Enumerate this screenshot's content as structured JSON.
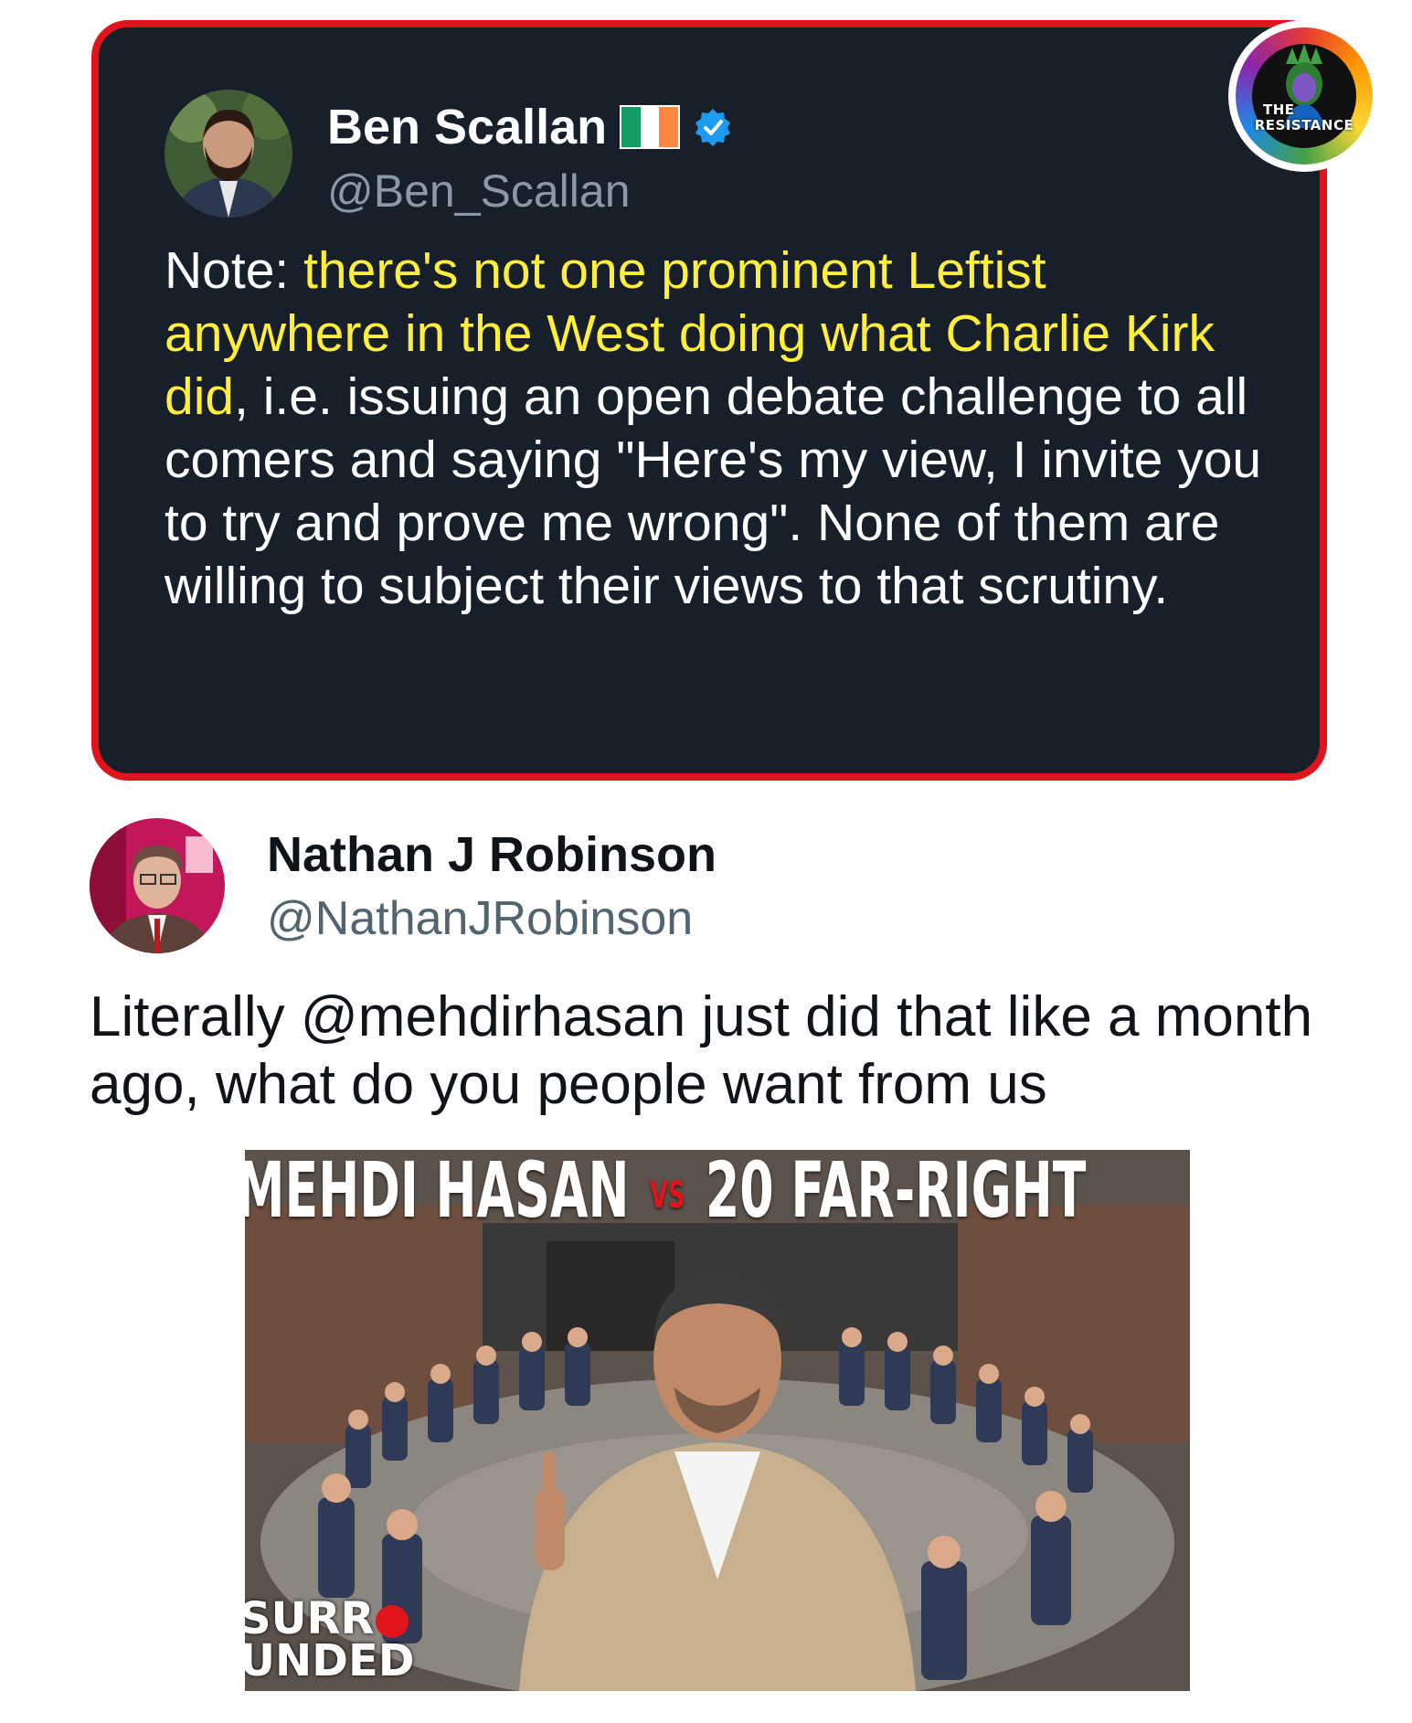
{
  "quoted_tweet": {
    "author_name": "Ben Scallan",
    "author_handle": "@Ben_Scallan",
    "flag_icon": "ireland-flag-icon",
    "verified_icon": "verified-badge-icon",
    "text_prefix": "Note: ",
    "text_highlight": "there's not one prominent Leftist anywhere in the West doing what Charlie Kirk did",
    "text_rest": ", i.e. issuing an open debate challenge to all comers and saying \"Here's my view, I invite you to try and prove me wrong\". None of them are willing to subject their views to that scrutiny.",
    "highlight_color": "#ffef3a",
    "border_color": "#e0151b",
    "background_color": "#17202a"
  },
  "badge": {
    "line1": "THE",
    "line2": "RESISTANCE"
  },
  "reply_tweet": {
    "author_name": "Nathan J Robinson",
    "author_handle": "@NathanJRobinson",
    "text": "Literally @mehdirhasan just did that like a month ago, what do you people want from us"
  },
  "thumbnail": {
    "title_left": "MEHDI HASAN",
    "title_vs": "VS",
    "title_right": "20 FAR-RIGHT",
    "brand_line1": "SURR",
    "brand_line2": "UNDED"
  }
}
